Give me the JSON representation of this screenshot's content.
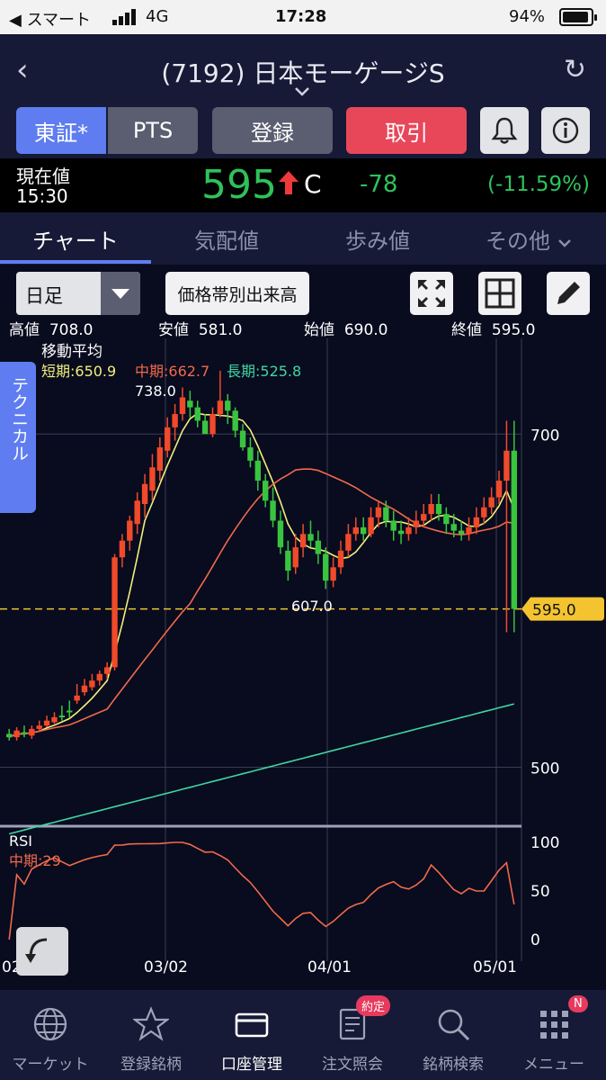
{
  "status_bar": {
    "carrier": "スマート",
    "network": "4G",
    "time": "17:28",
    "battery": "94%"
  },
  "header": {
    "title": "(7192) 日本モーゲージS"
  },
  "toolbar": {
    "tosho_label": "東証*",
    "pts_label": "PTS",
    "register_label": "登録",
    "trade_label": "取引"
  },
  "price": {
    "label": "現在値",
    "time": "15:30",
    "value": "595",
    "flag": "C",
    "change": "-78",
    "change_pct": "(-11.59%)"
  },
  "tabs": [
    {
      "label": "チャート"
    },
    {
      "label": "気配値"
    },
    {
      "label": "歩み値"
    },
    {
      "label": "その他"
    }
  ],
  "chart_controls": {
    "period": "日足",
    "volume_button": "価格帯別出来高"
  },
  "ohlc": {
    "high_label": "高値",
    "high": "708.0",
    "low_label": "安値",
    "low": "581.0",
    "open_label": "始値",
    "open": "690.0",
    "close_label": "終値",
    "close": "595.0"
  },
  "technical_tab": "テクニカル",
  "chart_data": {
    "type": "candlestick",
    "ma_title": "移動平均",
    "ma_short": "短期:650.9",
    "ma_mid": "中期:662.7",
    "ma_long": "長期:525.8",
    "annotations": {
      "max": "738.0",
      "min": "607.0",
      "current": "595.0"
    },
    "y_ticks": [
      "700",
      "500"
    ],
    "x_ticks": [
      "02",
      "03/02",
      "04/01",
      "05/01"
    ],
    "ylim": [
      470,
      752
    ],
    "series_colors": {
      "up": "#f04a2a",
      "down": "#39c43f",
      "short": "#f0f07a",
      "mid": "#f06a4a",
      "long": "#3fd6a0",
      "current": "#f3c42f"
    },
    "candles": [
      [
        520,
        518,
        523,
        516
      ],
      [
        518,
        522,
        524,
        516
      ],
      [
        521,
        520,
        525,
        518
      ],
      [
        519,
        523,
        525,
        517
      ],
      [
        523,
        525,
        528,
        521
      ],
      [
        525,
        528,
        531,
        524
      ],
      [
        527,
        530,
        533,
        526
      ],
      [
        531,
        530,
        537,
        528
      ],
      [
        534,
        533,
        540,
        530
      ],
      [
        540,
        543,
        550,
        538
      ],
      [
        545,
        549,
        553,
        543
      ],
      [
        548,
        552,
        556,
        546
      ],
      [
        552,
        556,
        558,
        549
      ],
      [
        556,
        560,
        563,
        553
      ],
      [
        560,
        626,
        628,
        558
      ],
      [
        626,
        636,
        640,
        620
      ],
      [
        636,
        648,
        651,
        630
      ],
      [
        646,
        660,
        665,
        640
      ],
      [
        658,
        670,
        676,
        650
      ],
      [
        666,
        680,
        688,
        660
      ],
      [
        678,
        692,
        698,
        672
      ],
      [
        690,
        704,
        710,
        686
      ],
      [
        704,
        712,
        718,
        696
      ],
      [
        712,
        722,
        728,
        708
      ],
      [
        720,
        716,
        726,
        710
      ],
      [
        716,
        708,
        720,
        704
      ],
      [
        708,
        700,
        712,
        702
      ],
      [
        700,
        712,
        716,
        698
      ],
      [
        712,
        720,
        738,
        710
      ],
      [
        720,
        714,
        724,
        706
      ],
      [
        714,
        702,
        716,
        698
      ],
      [
        702,
        692,
        706,
        690
      ],
      [
        692,
        684,
        698,
        680
      ],
      [
        684,
        672,
        690,
        666
      ],
      [
        672,
        660,
        676,
        656
      ],
      [
        660,
        648,
        668,
        644
      ],
      [
        648,
        632,
        654,
        628
      ],
      [
        630,
        618,
        636,
        612
      ],
      [
        620,
        632,
        640,
        616
      ],
      [
        632,
        640,
        646,
        626
      ],
      [
        640,
        636,
        648,
        632
      ],
      [
        636,
        628,
        642,
        622
      ],
      [
        628,
        612,
        632,
        607
      ],
      [
        612,
        620,
        626,
        608
      ],
      [
        620,
        630,
        636,
        616
      ],
      [
        630,
        640,
        646,
        626
      ],
      [
        640,
        644,
        650,
        636
      ],
      [
        644,
        640,
        650,
        636
      ],
      [
        640,
        650,
        656,
        638
      ],
      [
        650,
        656,
        660,
        644
      ],
      [
        656,
        648,
        660,
        644
      ],
      [
        648,
        642,
        654,
        636
      ],
      [
        642,
        640,
        648,
        634
      ],
      [
        640,
        644,
        650,
        636
      ],
      [
        644,
        648,
        654,
        640
      ],
      [
        648,
        652,
        658,
        644
      ],
      [
        652,
        658,
        664,
        648
      ],
      [
        658,
        652,
        664,
        648
      ],
      [
        652,
        646,
        656,
        640
      ],
      [
        646,
        642,
        652,
        638
      ],
      [
        642,
        640,
        648,
        636
      ],
      [
        640,
        644,
        650,
        636
      ],
      [
        644,
        650,
        656,
        640
      ],
      [
        650,
        656,
        662,
        646
      ],
      [
        656,
        662,
        668,
        652
      ],
      [
        662,
        672,
        678,
        658
      ],
      [
        672,
        690,
        708,
        581
      ],
      [
        690,
        595,
        708,
        581
      ]
    ],
    "rsi": {
      "label": "RSI",
      "mid_label": "中期:29",
      "y_ticks": [
        "100",
        "50",
        "0"
      ]
    }
  },
  "bottom_nav": [
    {
      "label": "マーケット",
      "icon": "globe-icon"
    },
    {
      "label": "登録銘柄",
      "icon": "star-icon"
    },
    {
      "label": "口座管理",
      "icon": "card-icon"
    },
    {
      "label": "注文照会",
      "icon": "document-icon",
      "badge": "約定"
    },
    {
      "label": "銘柄検索",
      "icon": "search-icon"
    },
    {
      "label": "メニュー",
      "icon": "menu-grid-icon",
      "badge": "N"
    }
  ]
}
